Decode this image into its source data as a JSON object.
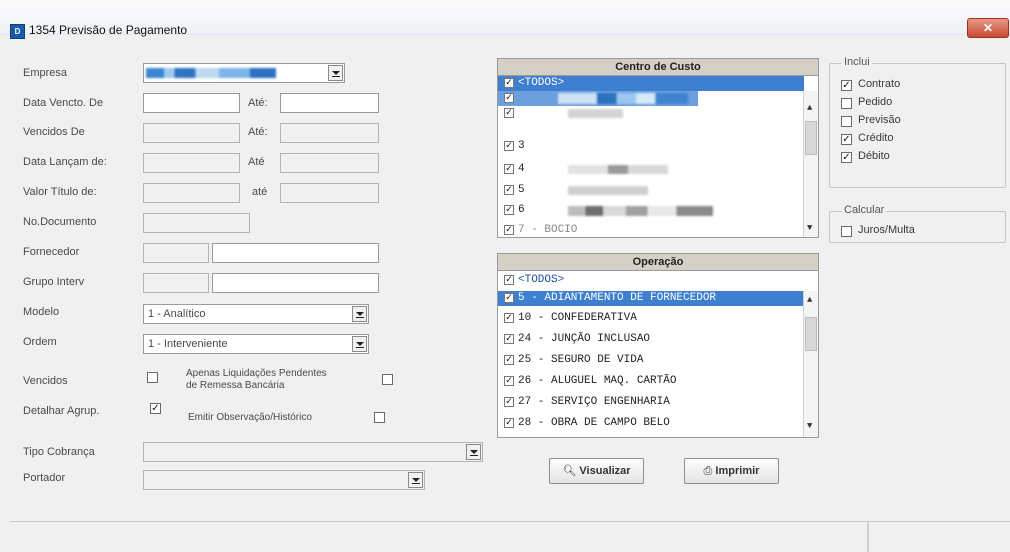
{
  "window": {
    "title": "1354 Previsão de Pagamento",
    "close_label": "✕"
  },
  "form": {
    "empresa_label": "Empresa",
    "data_vencto_de_label": "Data Vencto. De",
    "ate_label_1": "Até:",
    "vencidos_de_label": "Vencidos De",
    "ate_label_2": "Até:",
    "data_lancam_de_label": "Data Lançam de:",
    "ate_label_3": "Até",
    "valor_titulo_de_label": "Valor Título  de:",
    "ate_label_4": "até",
    "no_documento_label": "No.Documento",
    "fornecedor_label": "Fornecedor",
    "grupo_interv_label": "Grupo Interv",
    "modelo_label": "Modelo",
    "modelo_value": "1 - Analítico",
    "ordem_label": "Ordem",
    "ordem_value": "1 - Interveniente",
    "vencidos_label": "Vencidos",
    "apenas_liq_line1": "Apenas Liquidações Pendentes",
    "apenas_liq_line2": "de Remessa Bancária",
    "detalhar_agrup_label": "Detalhar Agrup.",
    "emitir_obs_label": "Emitir Observação/Histórico",
    "tipo_cobranca_label": "Tipo Cobrança",
    "portador_label": "Portador",
    "check_mark": "✓"
  },
  "centro_custo": {
    "header": "Centro de Custo",
    "items": [
      {
        "text": "<TODOS>"
      },
      {
        "text": ""
      },
      {
        "text": ""
      },
      {
        "text": "3"
      },
      {
        "text": "4"
      },
      {
        "text": "5"
      },
      {
        "text": "6"
      },
      {
        "text": "7   - BOCIO"
      }
    ]
  },
  "operacao": {
    "header": "Operação",
    "items": [
      {
        "text": "<TODOS>"
      },
      {
        "text": "5 - ADIANTAMENTO DE FORNECEDOR"
      },
      {
        "text": "10 - CONFEDERATIVA"
      },
      {
        "text": "24 - JUNÇÃO INCLUSAO"
      },
      {
        "text": "25 - SEGURO DE VIDA"
      },
      {
        "text": "26 - ALUGUEL MAQ. CARTÃO"
      },
      {
        "text": "27 - SERVIÇO ENGENHARIA"
      },
      {
        "text": "28 - OBRA DE CAMPO BELO"
      }
    ]
  },
  "inclui": {
    "title": "Inclui",
    "options": [
      {
        "label": "Contrato",
        "checked": true
      },
      {
        "label": "Pedido",
        "checked": false
      },
      {
        "label": "Previsão",
        "checked": false
      },
      {
        "label": "Crédito",
        "checked": true
      },
      {
        "label": "Débito",
        "checked": true
      }
    ]
  },
  "calcular": {
    "title": "Calcular",
    "option_label": "Juros/Multa"
  },
  "buttons": {
    "visualizar": "Visualizar",
    "imprimir": "Imprimir"
  },
  "colors": {
    "selection": "#3e7fd0",
    "close": "#c84a30"
  }
}
